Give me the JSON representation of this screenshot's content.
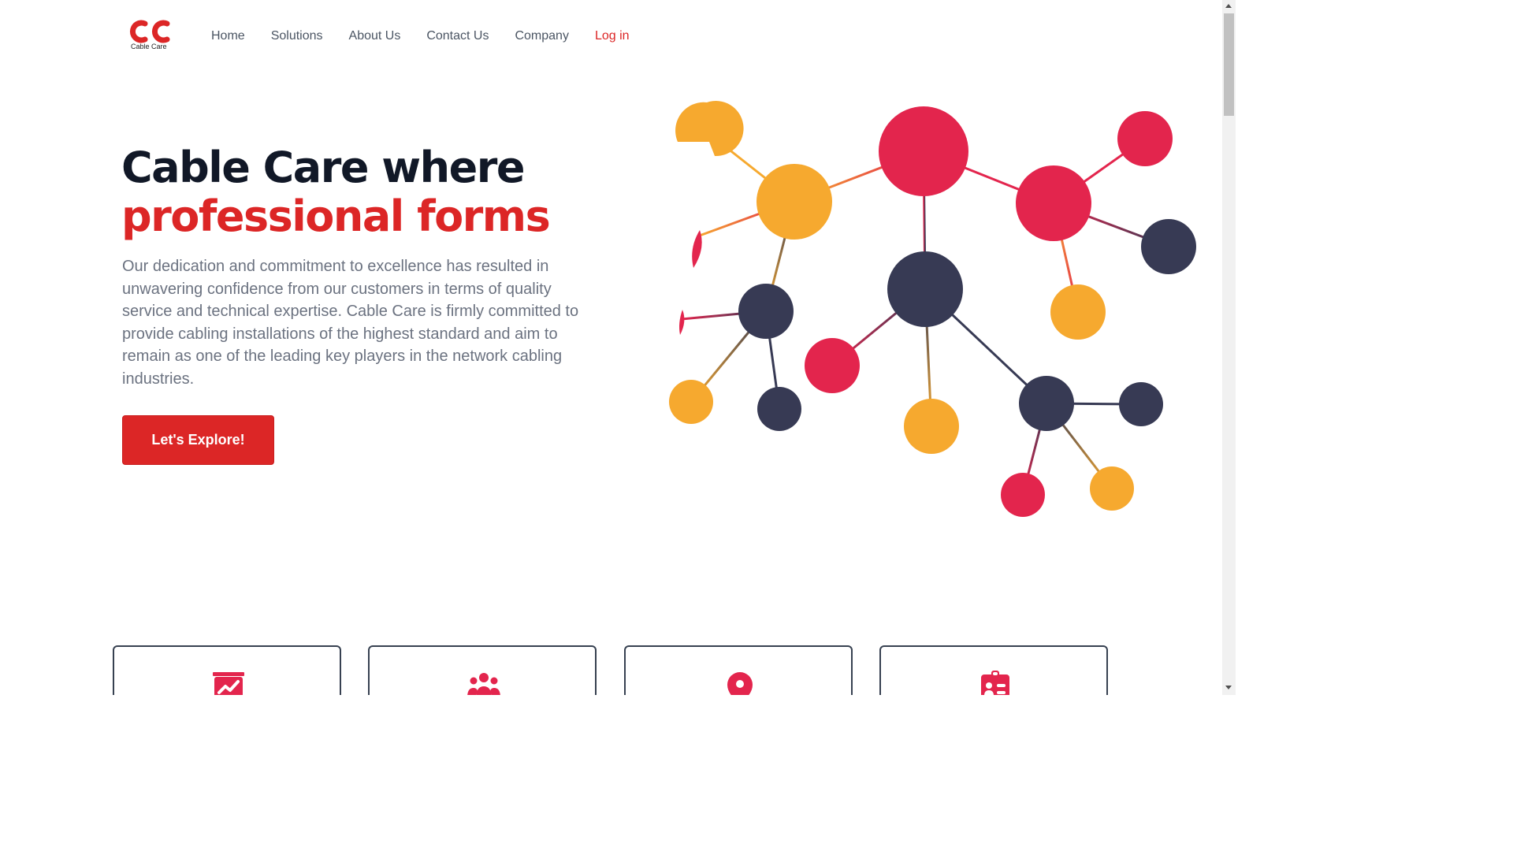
{
  "brand": {
    "name": "Cable Care",
    "color": "#dc2626"
  },
  "nav": {
    "items": [
      "Home",
      "Solutions",
      "About Us",
      "Contact Us",
      "Company"
    ],
    "login_label": "Log in"
  },
  "hero": {
    "title_line1": "Cable Care where",
    "title_line2": "professional forms",
    "description": "Our dedication and commitment to excellence has resulted in unwavering confidence from our customers in terms of quality service and technical expertise. Cable Care is firmly committed to provide cabling installations of the highest standard and aim to remain as one of the leading key players in the network cabling industries.",
    "cta_label": "Let's Explore!"
  },
  "illustration": {
    "name": "network-molecule-illustration",
    "colors": {
      "red": "#e3254d",
      "orange": "#f6a92f",
      "navy": "#373a54"
    }
  },
  "features": {
    "icons": [
      "chart-icon",
      "team-icon",
      "location-pin-icon",
      "clipboard-user-icon"
    ]
  }
}
